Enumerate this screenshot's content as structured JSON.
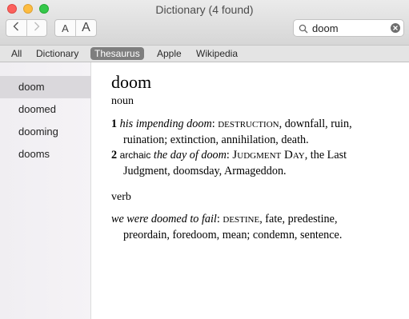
{
  "window": {
    "title": "Dictionary (4 found)"
  },
  "toolbar": {
    "back_icon": "chevron-left-icon",
    "forward_icon": "chevron-right-icon",
    "font_smaller_label": "A",
    "font_larger_label": "A",
    "search_value": "doom"
  },
  "tabs": [
    {
      "label": "All",
      "selected": false
    },
    {
      "label": "Dictionary",
      "selected": false
    },
    {
      "label": "Thesaurus",
      "selected": true
    },
    {
      "label": "Apple",
      "selected": false
    },
    {
      "label": "Wikipedia",
      "selected": false
    }
  ],
  "sidebar": {
    "items": [
      {
        "label": "doom",
        "selected": true
      },
      {
        "label": "doomed",
        "selected": false
      },
      {
        "label": "dooming",
        "selected": false
      },
      {
        "label": "dooms",
        "selected": false
      }
    ]
  },
  "entry": {
    "headword": "doom",
    "noun": {
      "pos": "noun",
      "sense1": {
        "num": "1",
        "example": "his impending doom",
        "colon": ":",
        "keyword": "destruction",
        "line1_rest": ", downfall, ruin,",
        "line2": "ruination; extinction, annihilation, death."
      },
      "sense2": {
        "num": "2",
        "register": "archaic",
        "example": "the day of doom",
        "colon": ":",
        "keyword": "Judgment Day",
        "line1_rest": ", the Last",
        "line2": "Judgment, doomsday, Armageddon."
      }
    },
    "verb": {
      "pos": "verb",
      "sense1": {
        "example": "we were doomed to fail",
        "colon": ":",
        "keyword": "destine",
        "line1_rest": ", fate, predestine,",
        "line2": "preordain, foredoom, mean; condemn, sentence."
      }
    }
  },
  "colors": {
    "selected_tab": "#7e7e7e",
    "selected_sidebar": "#dad8dc",
    "close": "#fc605c",
    "minimize": "#fdbc40",
    "maximize": "#34c84a"
  }
}
